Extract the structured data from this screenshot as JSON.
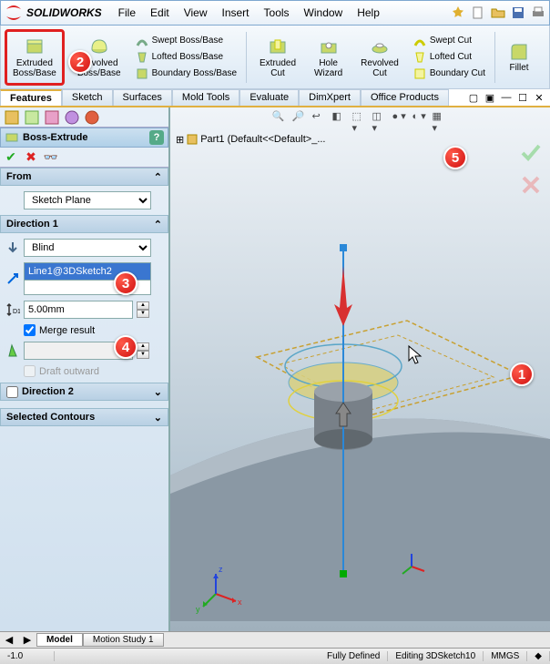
{
  "title": "SOLIDWORKS",
  "menu": [
    "File",
    "Edit",
    "View",
    "Insert",
    "Tools",
    "Window",
    "Help"
  ],
  "ribbon": {
    "extruded_boss": "Extruded\nBoss/Base",
    "revolved_boss": "Revolved\nBoss/Base",
    "swept": "Swept Boss/Base",
    "lofted": "Lofted Boss/Base",
    "boundary": "Boundary Boss/Base",
    "extruded_cut": "Extruded\nCut",
    "hole_wizard": "Hole\nWizard",
    "revolved_cut": "Revolved\nCut",
    "swept_cut": "Swept Cut",
    "lofted_cut": "Lofted Cut",
    "boundary_cut": "Boundary Cut",
    "fillet": "Fillet"
  },
  "cmd_tabs": [
    "Features",
    "Sketch",
    "Surfaces",
    "Mold Tools",
    "Evaluate",
    "DimXpert",
    "Office Products"
  ],
  "cmd_tab_active": 0,
  "feature": {
    "name": "Boss-Extrude",
    "from_label": "From",
    "from_value": "Sketch Plane",
    "dir1_label": "Direction 1",
    "end_condition": "Blind",
    "direction_ref": "Line1@3DSketch2",
    "depth": "5.00mm",
    "merge": "Merge result",
    "draft_outward": "Draft outward",
    "dir2_label": "Direction 2",
    "sel_contours": "Selected Contours"
  },
  "annotations": {
    "a1": "1",
    "a2": "2",
    "a3": "3",
    "a4": "4",
    "a5": "5"
  },
  "tree_root": "Part1 (Default<<Default>_...",
  "bottom_tabs": [
    "Model",
    "Motion Study 1"
  ],
  "status": {
    "coord": "-1.0",
    "defined": "Fully Defined",
    "editing": "Editing 3DSketch10",
    "units": "MMGS"
  }
}
